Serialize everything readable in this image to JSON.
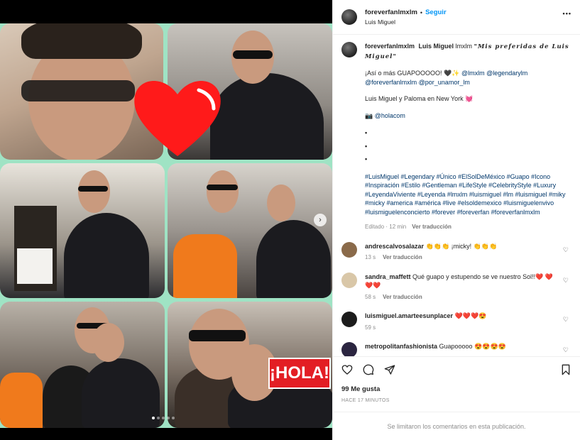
{
  "media": {
    "hola_logo": "¡HOLA!",
    "next_arrow": "›",
    "carousel_dots": 5,
    "active_dot": 0
  },
  "header": {
    "username": "foreverfanlmxlm",
    "separator": "•",
    "follow_label": "Seguir",
    "subtitle": "Luis Miguel",
    "more_label": "•••"
  },
  "caption": {
    "username": "foreverfanlmxlm",
    "bold_name": "Luis Miguel",
    "name_suffix": " lmxlm ",
    "script_title": "\"𝑴𝒊𝒔 𝒑𝒓𝒆𝒇𝒆𝒓𝒊𝒅𝒂𝒔 𝒅𝒆 𝑳𝒖𝒊𝒔 𝑴𝒊𝒈𝒖𝒆𝒍\"",
    "line1": "¡Así o más GUAPOOOOO! 🖤✨ ",
    "mentions1": "@lmxlm @legendarylm @foreverfanlmxlm @por_unamor_lm",
    "line2": "Luis Miguel y Paloma en New York 💓",
    "camera": "📷 ",
    "mention2": "@holacom",
    "bullets": [
      "•",
      "•",
      "•"
    ],
    "hashtags": "#LuisMiguel #Legendary #Único #ElSolDeMéxico #Guapo #Icono #Inspiración #Estilo #Gentleman #LifeStyle #CelebrityStyle #Luxury #LeyendaViviente #Leyenda #lmxlm #luismiguel #lm #luismiguel #miky #micky #america #américa #live #elsoldemexico #luismiguelenvivo #luismiguelenconcierto #forever #foreverfan #foreverfanlmxlm",
    "edited": "Editado · 12 min",
    "translate": "Ver traducción"
  },
  "comments": [
    {
      "username": "andrescalvosalazar",
      "text": " 👏👏👏 ¡micky! 👏👏👏",
      "time": "13 s",
      "translate": "Ver traducción",
      "avatar_color": "#8a6a4a"
    },
    {
      "username": "sandra_maffett",
      "text": " Qué guapo y estupendo se ve nuestro Sol!!❤️ ❤️❤️❤️",
      "time": "58 s",
      "translate": "Ver traducción",
      "avatar_color": "#d9c7a8"
    },
    {
      "username": "luismiguel.amarteesunplacer",
      "text": " ❤️❤️❤️😍",
      "time": "59 s",
      "translate": "",
      "avatar_color": "#1c1c1c"
    },
    {
      "username": "metropolitanfashionista",
      "text": " Guapooooo 😍😍😍😍",
      "time": "",
      "translate": "",
      "avatar_color": "#2b2540"
    }
  ],
  "actions": {
    "likes": "99 Me gusta",
    "time_ago": "HACE 17 MINUTOS"
  },
  "footer": {
    "notice": "Se limitaron los comentarios en esta publicación."
  },
  "colors": {
    "link": "#00376b",
    "follow": "#0095f6",
    "collage_bg": "#9fe3c4",
    "heart": "#ff1a1a"
  }
}
